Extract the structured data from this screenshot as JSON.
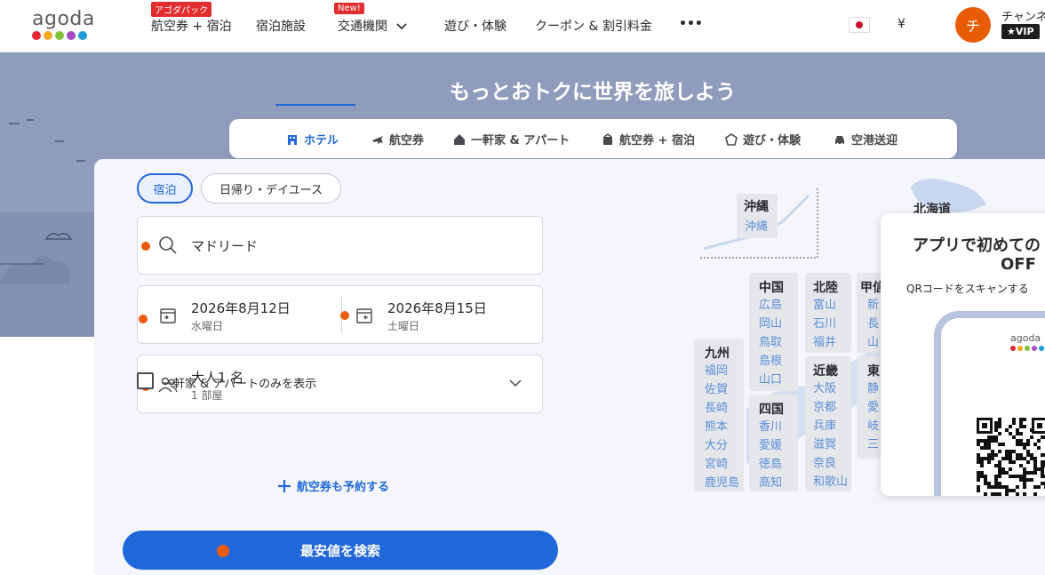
{
  "header": {
    "logo_text": "agoda",
    "logo_colors": [
      "#e3262f",
      "#f7a823",
      "#7fbf3a",
      "#a64bc2",
      "#1e9ad6"
    ],
    "nav": [
      {
        "label": "航空券 + 宿泊",
        "badge": "アゴダパック"
      },
      {
        "label": "宿泊施設",
        "badge": ""
      },
      {
        "label": "交通機関",
        "badge": "New!"
      },
      {
        "label": "遊び・体験",
        "badge": ""
      },
      {
        "label": "クーポン & 割引料金",
        "badge": ""
      },
      {
        "label": "•••",
        "badge": ""
      }
    ],
    "currency": "¥",
    "avatar_initial": "チ",
    "username": "チャンネ",
    "vip": "★VIP"
  },
  "hero": {
    "title": "もっとおトクに世界を旅しよう"
  },
  "tabs": [
    {
      "label": "ホテル",
      "icon": "hotel-icon",
      "active": true
    },
    {
      "label": "航空券",
      "icon": "plane-icon",
      "active": false
    },
    {
      "label": "一軒家 & アパート",
      "icon": "house-icon",
      "active": false
    },
    {
      "label": "航空券 + 宿泊",
      "icon": "package-icon",
      "active": false
    },
    {
      "label": "遊び・体験",
      "icon": "activity-icon",
      "active": false
    },
    {
      "label": "空港送迎",
      "icon": "car-icon",
      "active": false
    }
  ],
  "search": {
    "stay_types": [
      "宿泊",
      "日帰り・デイユース"
    ],
    "destination": "マドリード",
    "checkin_date": "2026年8月12日",
    "checkin_day": "水曜日",
    "checkout_date": "2026年8月15日",
    "checkout_day": "土曜日",
    "guests": "大人1 名",
    "rooms": "1 部屋",
    "homes_only_label": "一軒家 & アパートのみを表示",
    "add_flight_label": "航空券も予約する",
    "search_button": "最安値を検索"
  },
  "map": {
    "okinawa": {
      "title": "沖縄",
      "prefs": [
        "沖縄"
      ]
    },
    "hokkaido": {
      "title": "北海道"
    },
    "chugoku": {
      "title": "中国",
      "prefs": [
        "広島",
        "岡山",
        "鳥取",
        "島根",
        "山口"
      ]
    },
    "hokuriku": {
      "title": "北陸",
      "prefs": [
        "富山",
        "石川",
        "福井"
      ]
    },
    "koshinetsu": {
      "title": "甲信",
      "prefs": [
        "新",
        "長",
        "山"
      ]
    },
    "kyushu": {
      "title": "九州",
      "prefs": [
        "福岡",
        "佐賀",
        "長崎",
        "熊本",
        "大分",
        "宮崎",
        "鹿児島"
      ]
    },
    "shikoku": {
      "title": "四国",
      "prefs": [
        "香川",
        "愛媛",
        "徳島",
        "高知"
      ]
    },
    "kinki": {
      "title": "近畿",
      "prefs": [
        "大阪",
        "京都",
        "兵庫",
        "滋賀",
        "奈良",
        "和歌山"
      ]
    },
    "tokai": {
      "title": "東",
      "prefs": [
        "静",
        "愛",
        "岐",
        "三"
      ]
    }
  },
  "promo": {
    "title": "アプリで初めての",
    "subtitle": "OFF",
    "qr_text": "QRコードをスキャンする",
    "app_logo": "agoda"
  }
}
